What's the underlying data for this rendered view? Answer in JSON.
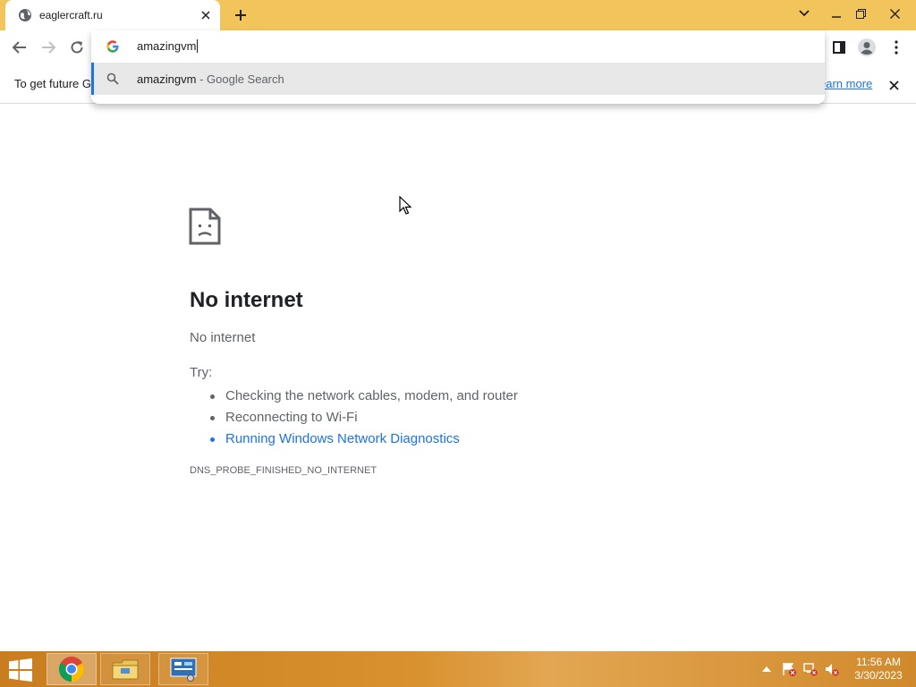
{
  "tab": {
    "title": "eaglercraft.ru",
    "favicon": "globe-icon"
  },
  "omnibox": {
    "value": "amazingvm",
    "suggestion": {
      "query": "amazingvm",
      "suffix": " - Google Search"
    }
  },
  "infobar": {
    "message": "To get future G",
    "learn_more": "earn more"
  },
  "error": {
    "title": "No internet",
    "subtitle": "No internet",
    "try_label": "Try:",
    "suggestions": [
      "Checking the network cables, modem, and router",
      "Reconnecting to Wi-Fi",
      "Running Windows Network Diagnostics"
    ],
    "code": "DNS_PROBE_FINISHED_NO_INTERNET"
  },
  "taskbar": {
    "apps": [
      "chrome-icon",
      "file-explorer-icon",
      "control-panel-icon"
    ],
    "time": "11:56 AM",
    "date": "3/30/2023"
  },
  "colors": {
    "titlebar": "#f2c55c",
    "accent": "#1a73e8",
    "taskbar": "#d8912e"
  }
}
